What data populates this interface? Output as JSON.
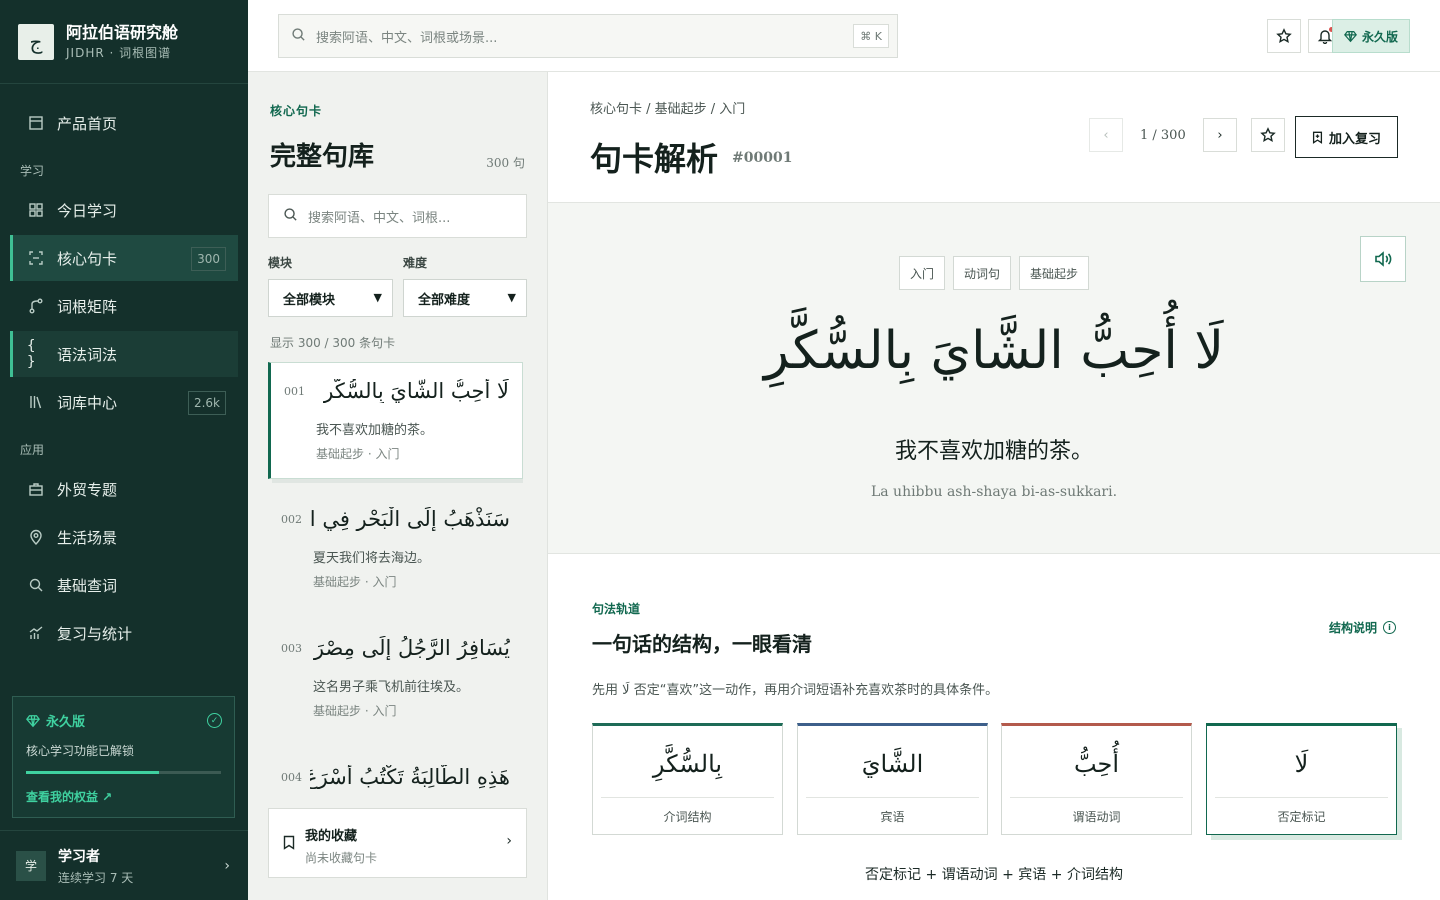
{
  "brand": {
    "logo": "ج",
    "name": "阿拉伯语研究舱",
    "sub": "JIDHR · 词根图谱"
  },
  "sidebar": {
    "home": "产品首页",
    "group_learn": "学习",
    "items_learn": [
      {
        "label": "今日学习",
        "icon": "grid-icon"
      },
      {
        "label": "核心句卡",
        "icon": "scan-icon",
        "badge": "300"
      },
      {
        "label": "词根矩阵",
        "icon": "branch-icon"
      },
      {
        "label": "语法词法",
        "icon": "braces-icon"
      },
      {
        "label": "词库中心",
        "icon": "library-icon",
        "badge": "2.6k"
      }
    ],
    "group_app": "应用",
    "items_app": [
      {
        "label": "外贸专题",
        "icon": "briefcase-icon"
      },
      {
        "label": "生活场景",
        "icon": "map-pin-icon"
      },
      {
        "label": "基础查词",
        "icon": "search-icon"
      },
      {
        "label": "复习与统计",
        "icon": "chart-icon"
      }
    ],
    "plan": {
      "title": "永久版",
      "desc": "核心学习功能已解锁",
      "progress": 0.68,
      "link": "查看我的权益 ↗"
    },
    "user": {
      "avatar": "学",
      "name": "学习者",
      "sub": "连续学习 7 天"
    }
  },
  "topbar": {
    "search_placeholder": "搜索阿语、中文、词根或场景...",
    "shortcut": "⌘ K",
    "plan_label": "永久版"
  },
  "list": {
    "kicker": "核心句卡",
    "title": "完整句库",
    "count": "300 句",
    "search_placeholder": "搜索阿语、中文、词根...",
    "filter_module_label": "模块",
    "filter_module_value": "全部模块",
    "filter_level_label": "难度",
    "filter_level_value": "全部难度",
    "showing": "显示 300 / 300 条句卡",
    "cards": [
      {
        "num": "001",
        "ar": "لَا أُحِبُّ الشَّايَ بِالسُّكَّرِ",
        "cn": "我不喜欢加糖的茶。",
        "meta": "基础起步 · 入门"
      },
      {
        "num": "002",
        "ar": "سَنَذْهَبُ إِلَى الْبَحْرِ فِي الـ...",
        "cn": "夏天我们将去海边。",
        "meta": "基础起步 · 入门"
      },
      {
        "num": "003",
        "ar": "يُسَافِرُ الرَّجُلُ إِلَى مِصْرَ بالـ...",
        "cn": "这名男子乘飞机前往埃及。",
        "meta": "基础起步 · 入门"
      },
      {
        "num": "004",
        "ar": "هَذِهِ الطَّالِبَةُ تَكْتُبُ أَسْرَعَ مِنِّي",
        "cn": "",
        "meta": ""
      }
    ],
    "favorites": {
      "title": "我的收藏",
      "sub": "尚未收藏句卡"
    }
  },
  "detail": {
    "breadcrumb": "核心句卡 / 基础起步 / 入门",
    "title": "句卡解析",
    "id": "#00001",
    "pager": "1 / 300",
    "review_label": "加入复习",
    "tags": [
      "入门",
      "动词句",
      "基础起步"
    ],
    "arabic": "لَا أُحِبُّ الشَّايَ بِالسُّكَّرِ",
    "chinese": "我不喜欢加糖的茶。",
    "translit": "La uhibbu ash-shaya bi-as-sukkari.",
    "syntax": {
      "kicker": "句法轨道",
      "title": "一句话的结构，一眼看清",
      "help": "结构说明",
      "desc": "先用 لَا 否定“喜欢”这一动作，再用介词短语补充喜欢茶时的具体条件。",
      "blocks": [
        {
          "ar": "بِالسُّكَّرِ",
          "label": "介词结构",
          "color": "#1e6b57"
        },
        {
          "ar": "الشَّايَ",
          "label": "宾语",
          "color": "#3d5f8a"
        },
        {
          "ar": "أُحِبُّ",
          "label": "谓语动词",
          "color": "#b35a4c"
        },
        {
          "ar": "لَا",
          "label": "否定标记",
          "color": "#11684f"
        }
      ],
      "formula": "否定标记 + 谓语动词 + 宾语 + 介词结构"
    }
  },
  "colors": {
    "accent": "#11684f",
    "sidebar_bg": "#14302b",
    "highlight": "#3fd1a0"
  }
}
